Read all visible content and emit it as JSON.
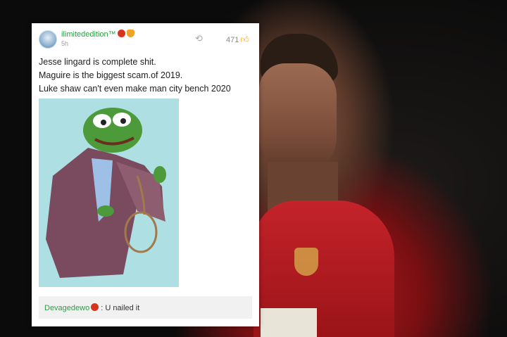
{
  "post": {
    "username": "ilimitededition™",
    "timestamp": "5h",
    "like_count": "471",
    "lines": [
      "Jesse lingard is complete shit.",
      "Maguire is the biggest scam.of 2019.",
      "Luke shaw can't even make man city bench 2020"
    ],
    "image_description_name": "pepe-meme-image"
  },
  "comment": {
    "author": "Devagedewo",
    "text": ": U nailed it"
  },
  "icons": {
    "share": "share-icon",
    "like": "thumbs-up-icon",
    "badge_red": "club-badge-icon",
    "badge_gold": "crown-badge-icon"
  },
  "colors": {
    "username_green": "#2e9b45",
    "like_gold": "#f0a32a",
    "shirt_red": "#c4232a",
    "meme_bg": "#aee0e3"
  }
}
